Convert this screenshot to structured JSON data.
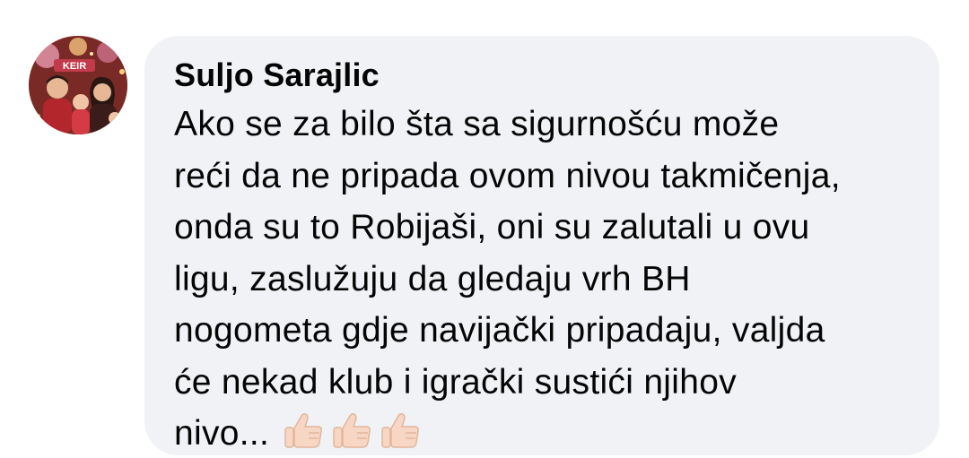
{
  "comment": {
    "author": "Suljo Sarajlic",
    "lines": [
      "Ako se za bilo šta sa sigurnošću može",
      "reći da ne pripada ovom nivou takmičenja,",
      "onda su to Robijaši, oni su zalutali u ovu",
      "ligu, zaslužuju da gledaju vrh BH",
      "nogometa gdje navijački pripadaju, valjda",
      "će nekad klub i igrački sustići njihov",
      "nivo..."
    ],
    "emojis": [
      "thumbs-up-icon",
      "thumbs-up-icon",
      "thumbs-up-icon"
    ],
    "avatar_label": "KEIR"
  },
  "colors": {
    "bubble_bg": "#f0f2f5",
    "text": "#050505",
    "emoji_skin": "#f7d7c4"
  }
}
